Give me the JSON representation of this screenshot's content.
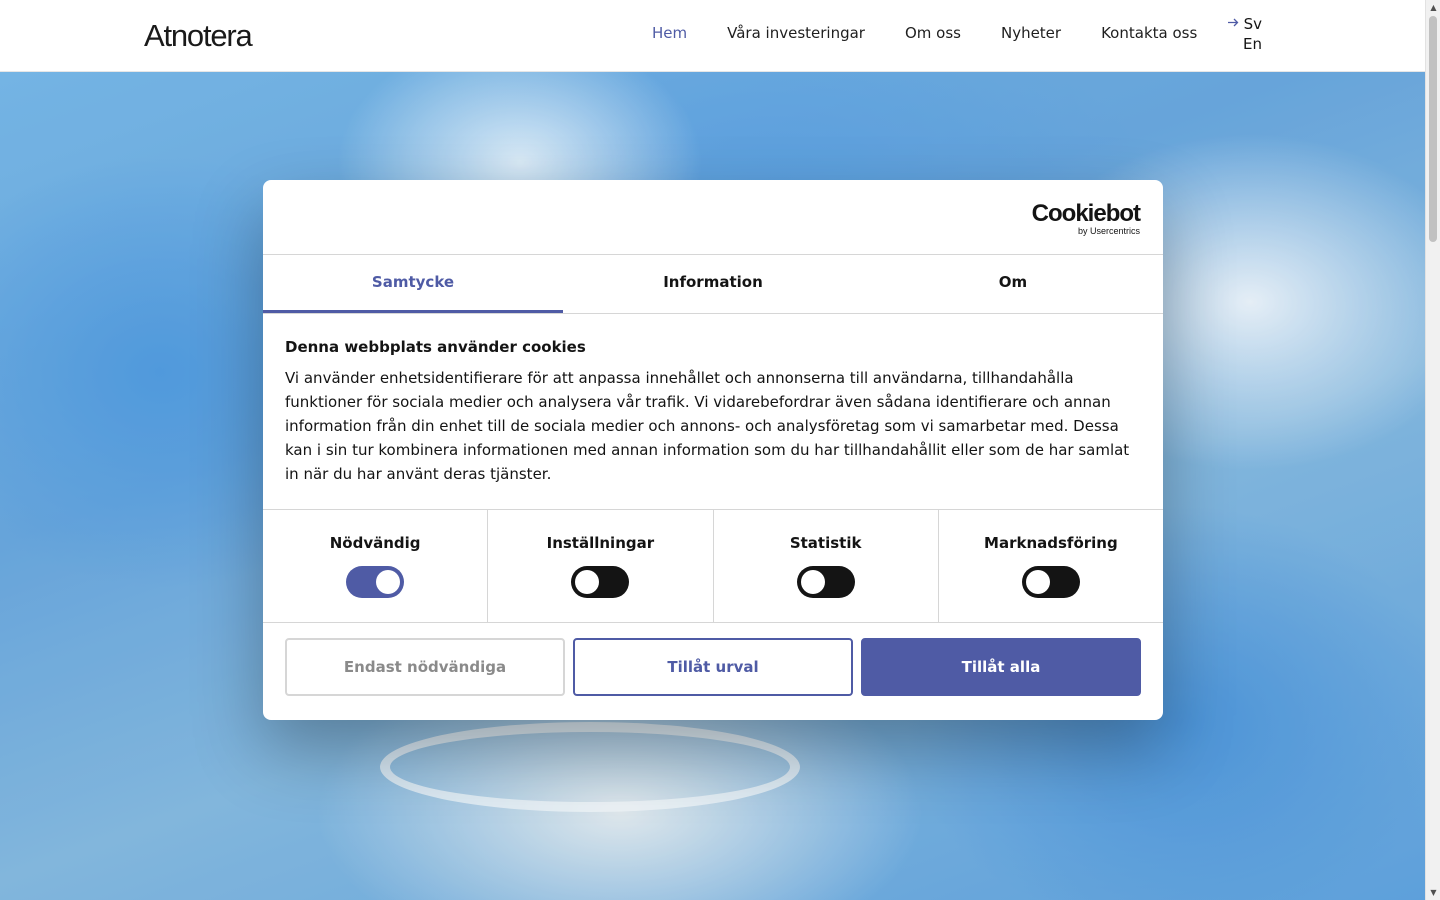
{
  "header": {
    "logo": "Atnotera",
    "nav": [
      {
        "label": "Hem",
        "active": true
      },
      {
        "label": "Våra investeringar",
        "active": false
      },
      {
        "label": "Om oss",
        "active": false
      },
      {
        "label": "Nyheter",
        "active": false
      },
      {
        "label": "Kontakta oss",
        "active": false
      }
    ],
    "languages": {
      "current": "Sv",
      "other": "En"
    }
  },
  "dialog": {
    "brand": {
      "name": "Cookiebot",
      "sub": "by Usercentrics"
    },
    "tabs": [
      {
        "label": "Samtycke",
        "active": true
      },
      {
        "label": "Information",
        "active": false
      },
      {
        "label": "Om",
        "active": false
      }
    ],
    "heading": "Denna webbplats använder cookies",
    "body": "Vi använder enhetsidentifierare för att anpassa innehållet och annonserna till användarna, tillhandahålla funktioner för sociala medier och analysera vår trafik. Vi vidarebefordrar även sådana identifierare och annan information från din enhet till de sociala medier och annons- och analysföretag som vi samarbetar med. Dessa kan i sin tur kombinera informationen med annan information som du har tillhandahållit eller som de har samlat in när du har använt deras tjänster.",
    "toggles": [
      {
        "label": "Nödvändig",
        "on": true
      },
      {
        "label": "Inställningar",
        "on": false
      },
      {
        "label": "Statistik",
        "on": false
      },
      {
        "label": "Marknadsföring",
        "on": false
      }
    ],
    "buttons": {
      "necessary": "Endast nödvändiga",
      "selection": "Tillåt urval",
      "all": "Tillåt alla"
    }
  },
  "colors": {
    "accent": "#4f5ba5",
    "text": "#141414",
    "toggle_off": "#141414"
  }
}
